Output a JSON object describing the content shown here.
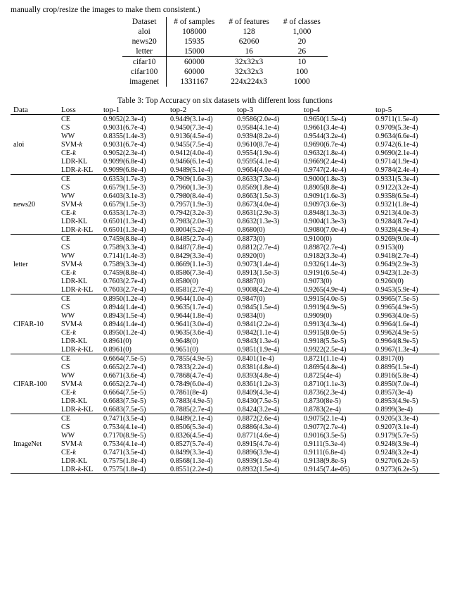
{
  "frag_text": "manually crop/resize the images to make them consistent.)",
  "dataset_table": {
    "headers": [
      "Dataset",
      "# of samples",
      "# of features",
      "# of classes"
    ],
    "groups": [
      [
        {
          "name": "aloi",
          "samples": "108000",
          "features": "128",
          "classes": "1,000"
        },
        {
          "name": "news20",
          "samples": "15935",
          "features": "62060",
          "classes": "20"
        },
        {
          "name": "letter",
          "samples": "15000",
          "features": "16",
          "classes": "26"
        }
      ],
      [
        {
          "name": "cifar10",
          "samples": "60000",
          "features": "32x32x3",
          "classes": "10"
        },
        {
          "name": "cifar100",
          "samples": "60000",
          "features": "32x32x3",
          "classes": "100"
        },
        {
          "name": "imagenet",
          "samples": "1331167",
          "features": "224x224x3",
          "classes": "1000"
        }
      ]
    ]
  },
  "caption": "Table 3: Top Accuracy on six datasets with different loss functions",
  "acc_headers": [
    "Data",
    "Loss",
    "top-1",
    "top-2",
    "top-3",
    "top-4",
    "top-5"
  ],
  "losses": [
    "CE",
    "CS",
    "WW",
    "SVM-k",
    "CE-k",
    "LDR-KL",
    "LDR-k-KL"
  ],
  "chart_data": {
    "type": "table",
    "datasets": [
      {
        "name": "aloi",
        "rows": [
          {
            "loss": "CE",
            "top1": "0.9052(2.3e-4)",
            "top2": "0.9449(3.1e-4)",
            "top3": "0.9586(2.0e-4)",
            "top4": "0.9650(1.5e-4)",
            "top5": "0.9711(1.5e-4)",
            "b": [
              0,
              0,
              0,
              0,
              0
            ]
          },
          {
            "loss": "CS",
            "top1": "0.9031(6.7e-4)",
            "top2": "0.9450(7.3e-4)",
            "top3": "0.9584(4.1e-4)",
            "top4": "0.9661(3.4e-4)",
            "top5": "0.9709(5.3e-4)",
            "b": [
              0,
              0,
              0,
              0,
              0
            ]
          },
          {
            "loss": "WW",
            "top1": "0.8355(1.4e-3)",
            "top2": "0.9136(4.5e-4)",
            "top3": "0.9394(8.2e-4)",
            "top4": "0.9544(3.2e-4)",
            "top5": "0.9634(6.6e-4)",
            "b": [
              0,
              0,
              0,
              0,
              0
            ]
          },
          {
            "loss": "SVM-k",
            "top1": "0.9031(6.7e-4)",
            "top2": "0.9455(7.5e-4)",
            "top3": "0.9610(8.7e-4)",
            "top4": "0.9690(6.7e-4)",
            "top5": "0.9742(6.1e-4)",
            "b": [
              0,
              0,
              0,
              0,
              0
            ]
          },
          {
            "loss": "CE-k",
            "top1": "0.9052(2.3e-4)",
            "top2": "0.9412(4.0e-4)",
            "top3": "0.9554(1.9e-4)",
            "top4": "0.9632(1.8e-4)",
            "top5": "0.9690(2.1e-4)",
            "b": [
              0,
              0,
              0,
              0,
              0
            ]
          },
          {
            "loss": "LDR-KL",
            "top1": "0.9099(6.8e-4)",
            "top2": "0.9466(6.1e-4)",
            "top3": "0.9595(4.1e-4)",
            "top4": "0.9669(2.4e-4)",
            "top5": "0.9714(1.9e-4)",
            "b": [
              1,
              0,
              0,
              0,
              0
            ]
          },
          {
            "loss": "LDR-k-KL",
            "top1": "0.9099(6.8e-4)",
            "top2": "0.9489(5.1e-4)",
            "top3": "0.9664(4.0e-4)",
            "top4": "0.9747(2.4e-4)",
            "top5": "0.9784(2.4e-4)",
            "b": [
              1,
              1,
              1,
              1,
              1
            ]
          }
        ]
      },
      {
        "name": "news20",
        "rows": [
          {
            "loss": "CE",
            "top1": "0.6353(1.7e-3)",
            "top2": "0.7909(1.6e-3)",
            "top3": "0.8633(7.3e-4)",
            "top4": "0.9000(1.8e-3)",
            "top5": "0.9331(5.3e-4)",
            "b": [
              0,
              0,
              0,
              0,
              0
            ]
          },
          {
            "loss": "CS",
            "top1": "0.6579(1.5e-3)",
            "top2": "0.7960(1.3e-3)",
            "top3": "0.8569(1.8e-4)",
            "top4": "0.8905(8.8e-4)",
            "top5": "0.9122(3.2e-4)",
            "b": [
              1,
              0,
              0,
              0,
              0
            ]
          },
          {
            "loss": "WW",
            "top1": "0.6403(3.1e-3)",
            "top2": "0.7980(8.4e-4)",
            "top3": "0.8663(1.5e-3)",
            "top4": "0.9091(1.6e-3)",
            "top5": "0.9358(6.5e-4)",
            "b": [
              0,
              0,
              0,
              0,
              1
            ]
          },
          {
            "loss": "SVM-k",
            "top1": "0.6579(1.5e-3)",
            "top2": "0.7957(1.9e-3)",
            "top3": "0.8673(4.0e-4)",
            "top4": "0.9097(3.6e-3)",
            "top5": "0.9321(1.8e-4)",
            "b": [
              1,
              0,
              0,
              1,
              0
            ]
          },
          {
            "loss": "CE-k",
            "top1": "0.6353(1.7e-3)",
            "top2": "0.7942(3.2e-3)",
            "top3": "0.8631(2.9e-3)",
            "top4": "0.8948(1.3e-3)",
            "top5": "0.9213(4.0e-3)",
            "b": [
              0,
              0,
              0,
              0,
              0
            ]
          },
          {
            "loss": "LDR-KL",
            "top1": "0.6501(1.3e-4)",
            "top2": "0.7983(2.0e-3)",
            "top3": "0.8632(1.3e-3)",
            "top4": "0.9004(1.3e-3)",
            "top5": "0.9284(8.7e-4)",
            "b": [
              0,
              0,
              0,
              0,
              0
            ]
          },
          {
            "loss": "LDR-k-KL",
            "top1": "0.6501(1.3e-4)",
            "top2": "0.8004(5.2e-4)",
            "top3": "0.8680(0)",
            "top4": "0.9080(7.0e-4)",
            "top5": "0.9328(4.9e-4)",
            "b": [
              0,
              1,
              1,
              0,
              0
            ]
          }
        ]
      },
      {
        "name": "letter",
        "rows": [
          {
            "loss": "CE",
            "top1": "0.7459(8.8e-4)",
            "top2": "0.8485(2.7e-4)",
            "top3": "0.8873(0)",
            "top4": "0.9100(0)",
            "top5": "0.9269(9.0e-4)",
            "b": [
              0,
              0,
              0,
              0,
              0
            ]
          },
          {
            "loss": "CS",
            "top1": "0.7589(3.3e-4)",
            "top2": "0.8487(7.8e-4)",
            "top3": "0.8812(2.7e-4)",
            "top4": "0.8987(2.7e-4)",
            "top5": "0.9153(0)",
            "b": [
              0,
              0,
              0,
              0,
              0
            ]
          },
          {
            "loss": "WW",
            "top1": "0.7141(1.4e-3)",
            "top2": "0.8429(3.3e-4)",
            "top3": "0.8920(0)",
            "top4": "0.9182(3.3e-4)",
            "top5": "0.9418(2.7e-4)",
            "b": [
              0,
              0,
              0,
              0,
              0
            ]
          },
          {
            "loss": "SVM-k",
            "top1": "0.7589(3.3e-4)",
            "top2": "0.8669(1.1e-3)",
            "top3": "0.9073(1.4e-4)",
            "top4": "0.9326(1.4e-3)",
            "top5": "0.9649(2.9e-3)",
            "b": [
              0,
              1,
              1,
              1,
              1
            ]
          },
          {
            "loss": "CE-k",
            "top1": "0.7459(8.8e-4)",
            "top2": "0.8586(7.3e-4)",
            "top3": "0.8913(1.5e-3)",
            "top4": "0.9191(6.5e-4)",
            "top5": "0.9423(1.2e-3)",
            "b": [
              0,
              0,
              0,
              0,
              0
            ]
          },
          {
            "loss": "LDR-KL",
            "top1": "0.7603(2.7e-4)",
            "top2": "0.8580(0)",
            "top3": "0.8887(0)",
            "top4": "0.9073(0)",
            "top5": "0.9260(0)",
            "b": [
              1,
              0,
              0,
              0,
              0
            ]
          },
          {
            "loss": "LDR-k-KL",
            "top1": "0.7603(2.7e-4)",
            "top2": "0.8581(2.7e-4)",
            "top3": "0.9008(4.2e-4)",
            "top4": "0.9265(4.9e-4)",
            "top5": "0.9453(5.9e-4)",
            "b": [
              1,
              0,
              0,
              0,
              0
            ]
          }
        ]
      },
      {
        "name": "CIFAR-10",
        "rows": [
          {
            "loss": "CE",
            "top1": "0.8950(1.2e-4)",
            "top2": "0.9644(1.0e-4)",
            "top3": "0.9847(0)",
            "top4": "0.9915(4.0e-5)",
            "top5": "0.9965(7.5e-5)",
            "b": [
              0,
              0,
              0,
              0,
              0
            ]
          },
          {
            "loss": "CS",
            "top1": "0.8944(1.4e-4)",
            "top2": "0.9635(1.7e-4)",
            "top3": "0.9845(1.5e-4)",
            "top4": "0.9919(4.9e-5)",
            "top5": "0.9965(4.9e-5)",
            "b": [
              0,
              0,
              0,
              0,
              0
            ]
          },
          {
            "loss": "WW",
            "top1": "0.8943(1.5e-4)",
            "top2": "0.9644(1.8e-4)",
            "top3": "0.9834(0)",
            "top4": "0.9909(0)",
            "top5": "0.9963(4.0e-5)",
            "b": [
              0,
              0,
              0,
              0,
              0
            ]
          },
          {
            "loss": "SVM-k",
            "top1": "0.8944(1.4e-4)",
            "top2": "0.9641(3.0e-4)",
            "top3": "0.9841(2.2e-4)",
            "top4": "0.9913(4.3e-4)",
            "top5": "0.9964(1.6e-4)",
            "b": [
              0,
              0,
              0,
              0,
              0
            ]
          },
          {
            "loss": "CE-k",
            "top1": "0.8950(1.2e-4)",
            "top2": "0.9635(3.6e-4)",
            "top3": "0.9842(1.1e-4)",
            "top4": "0.9915(8.0e-5)",
            "top5": "0.9962(4.9e-5)",
            "b": [
              0,
              0,
              0,
              0,
              0
            ]
          },
          {
            "loss": "LDR-KL",
            "top1": "0.8961(0)",
            "top2": "0.9648(0)",
            "top3": "0.9843(1.3e-4)",
            "top4": "0.9918(5.5e-5)",
            "top5": "0.9964(8.9e-5)",
            "b": [
              1,
              0,
              0,
              0,
              0
            ]
          },
          {
            "loss": "LDR-k-KL",
            "top1": "0.8961(0)",
            "top2": "0.9651(0)",
            "top3": "0.9851(1.9e-4)",
            "top4": "0.9922(2.5e-4)",
            "top5": "0.9967(1.3e-4)",
            "b": [
              1,
              1,
              1,
              1,
              1
            ]
          }
        ]
      },
      {
        "name": "CIFAR-100",
        "rows": [
          {
            "loss": "CE",
            "top1": "0.6664(7.5e-5)",
            "top2": "0.7855(4.9e-5)",
            "top3": "0.8401(1e-4)",
            "top4": "0.8721(1.1e-4)",
            "top5": "0.8917(0)",
            "b": [
              0,
              0,
              0,
              0,
              0
            ]
          },
          {
            "loss": "CS",
            "top1": "0.6652(2.7e-4)",
            "top2": "0.7833(2.2e-4)",
            "top3": "0.8381(4.8e-4)",
            "top4": "0.8695(4.8e-4)",
            "top5": "0.8895(1.5e-4)",
            "b": [
              0,
              0,
              0,
              0,
              0
            ]
          },
          {
            "loss": "WW",
            "top1": "0.6671(3.6e-4)",
            "top2": "0.7868(4.7e-4)",
            "top3": "0.8393(4.8e-4)",
            "top4": "0.8725(4e-4)",
            "top5": "0.8916(5.8e-4)",
            "b": [
              0,
              0,
              0,
              0,
              0
            ]
          },
          {
            "loss": "SVM-k",
            "top1": "0.6652(2.7e-4)",
            "top2": "0.7849(6.0e-4)",
            "top3": "0.8361(1.2e-3)",
            "top4": "0.8710(1.1e-3)",
            "top5": "0.8950(7.0e-4)",
            "b": [
              0,
              0,
              0,
              0,
              0
            ]
          },
          {
            "loss": "CE-k",
            "top1": "0.6664(7.5e-5)",
            "top2": "0.7861(8e-4)",
            "top3": "0.8409(4.3e-4)",
            "top4": "0.8736(2.3e-4)",
            "top5": "0.8957(3e-4)",
            "b": [
              0,
              0,
              0,
              0,
              0
            ]
          },
          {
            "loss": "LDR-KL",
            "top1": "0.6683(7.5e-5)",
            "top2": "0.7883(4.9e-5)",
            "top3": "0.8430(7.5e-5)",
            "top4": "0.8730(8e-5)",
            "top5": "0.8953(4.9e-5)",
            "b": [
              1,
              0,
              1,
              0,
              0
            ]
          },
          {
            "loss": "LDR-k-KL",
            "top1": "0.6683(7.5e-5)",
            "top2": "0.7885(2.7e-4)",
            "top3": "0.8424(3.2e-4)",
            "top4": "0.8783(2e-4)",
            "top5": "0.8999(3e-4)",
            "b": [
              1,
              1,
              0,
              1,
              1
            ]
          }
        ]
      },
      {
        "name": "ImageNet",
        "rows": [
          {
            "loss": "CE",
            "top1": "0.7471(3.5e-4)",
            "top2": "0.8489(2.1e-4)",
            "top3": "0.8872(2.6e-4)",
            "top4": "0.9075(2.1e-4)",
            "top5": "0.9205(3.3e-4)",
            "b": [
              0,
              0,
              0,
              0,
              0
            ]
          },
          {
            "loss": "CS",
            "top1": "0.7534(4.1e-4)",
            "top2": "0.8506(5.3e-4)",
            "top3": "0.8886(4.3e-4)",
            "top4": "0.9077(2.7e-4)",
            "top5": "0.9207(3.1e-4)",
            "b": [
              0,
              0,
              0,
              0,
              0
            ]
          },
          {
            "loss": "WW",
            "top1": "0.7170(8.9e-5)",
            "top2": "0.8326(4.5e-4)",
            "top3": "0.8771(4.6e-4)",
            "top4": "0.9016(3.5e-5)",
            "top5": "0.9179(5.7e-5)",
            "b": [
              0,
              0,
              0,
              0,
              0
            ]
          },
          {
            "loss": "SVM-k",
            "top1": "0.7534(4.1e-4)",
            "top2": "0.8527(5.7e-4)",
            "top3": "0.8915(4.7e-4)",
            "top4": "0.9111(5.3e-4)",
            "top5": "0.9248(3.9e-4)",
            "b": [
              0,
              0,
              0,
              0,
              0
            ]
          },
          {
            "loss": "CE-k",
            "top1": "0.7471(3.5e-4)",
            "top2": "0.8499(3.3e-4)",
            "top3": "0.8896(3.9e-4)",
            "top4": "0.9111(6.8e-4)",
            "top5": "0.9248(3.2e-4)",
            "b": [
              0,
              0,
              0,
              0,
              0
            ]
          },
          {
            "loss": "LDR-KL",
            "top1": "0.7575(1.8e-4)",
            "top2": "0.8568(1.3e-4)",
            "top3": "0.8939(1.5e-4)",
            "top4": "0.9138(9.8e-5)",
            "top5": "0.9270(6.2e-5)",
            "b": [
              1,
              1,
              1,
              0,
              0
            ]
          },
          {
            "loss": "LDR-k-KL",
            "top1": "0.7575(1.8e-4)",
            "top2": "0.8551(2.2e-4)",
            "top3": "0.8932(1.5e-4)",
            "top4": "0.9145(7.4e-05)",
            "top5": "0.9273(6.2e-5)",
            "b": [
              1,
              0,
              0,
              1,
              1
            ]
          }
        ]
      }
    ]
  }
}
